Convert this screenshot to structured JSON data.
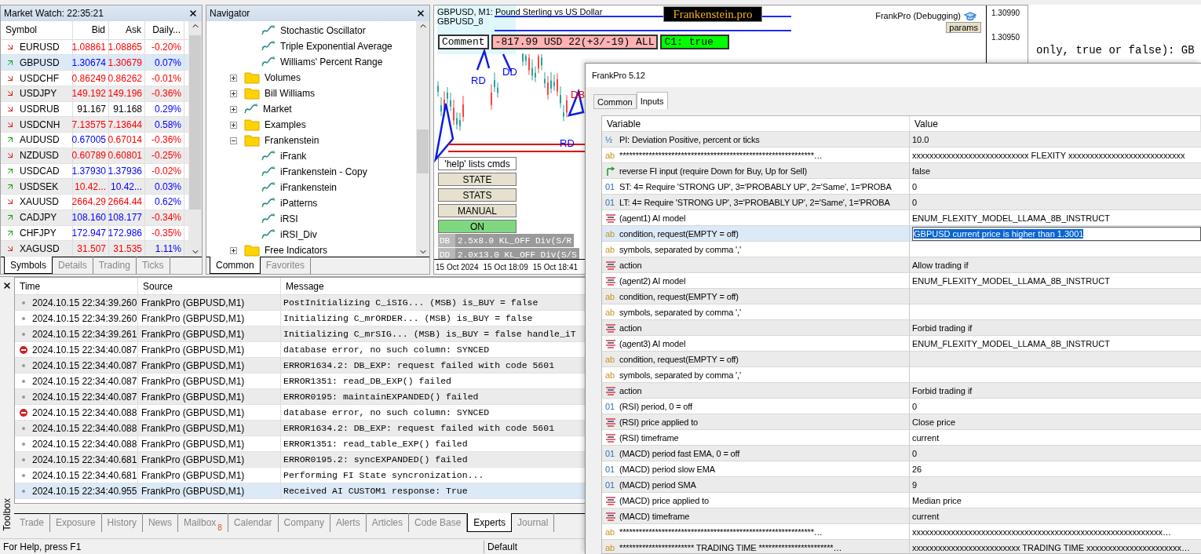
{
  "market_watch": {
    "title": "Market Watch: 22:35:21",
    "columns": [
      "Symbol",
      "Bid",
      "Ask",
      "Daily..."
    ],
    "rows": [
      {
        "symbol": "EURUSD",
        "rising": false,
        "selected": false,
        "bid": {
          "text": "1.08861",
          "color": "#ff0000"
        },
        "ask": {
          "text": "1.08865",
          "color": "#ff0000"
        },
        "daily": {
          "text": "-0.20%",
          "color": "#ff0000"
        }
      },
      {
        "symbol": "GBPUSD",
        "rising": true,
        "selected": true,
        "bid": {
          "text": "1.30674",
          "color": "#0000ff"
        },
        "ask": {
          "text": "1.30679",
          "color": "#ff0000"
        },
        "daily": {
          "text": "0.07%",
          "color": "#0000ff"
        }
      },
      {
        "symbol": "USDCHF",
        "rising": false,
        "selected": false,
        "bid": {
          "text": "0.86249",
          "color": "#ff0000"
        },
        "ask": {
          "text": "0.86262",
          "color": "#ff0000"
        },
        "daily": {
          "text": "-0.01%",
          "color": "#ff0000"
        }
      },
      {
        "symbol": "USDJPY",
        "rising": false,
        "selected": false,
        "bid": {
          "text": "149.192",
          "color": "#ff0000"
        },
        "ask": {
          "text": "149.196",
          "color": "#ff0000"
        },
        "daily": {
          "text": "-0.36%",
          "color": "#ff0000"
        }
      },
      {
        "symbol": "USDRUB",
        "rising": false,
        "selected": false,
        "bid": {
          "text": "91.167",
          "color": "#000000"
        },
        "ask": {
          "text": "91.168",
          "color": "#000000"
        },
        "daily": {
          "text": "0.29%",
          "color": "#0000ff"
        }
      },
      {
        "symbol": "USDCNH",
        "rising": false,
        "selected": false,
        "bid": {
          "text": "7.13575",
          "color": "#ff0000"
        },
        "ask": {
          "text": "7.13644",
          "color": "#ff0000"
        },
        "daily": {
          "text": "0.58%",
          "color": "#0000ff"
        }
      },
      {
        "symbol": "AUDUSD",
        "rising": true,
        "selected": false,
        "bid": {
          "text": "0.67005",
          "color": "#0000ff"
        },
        "ask": {
          "text": "0.67014",
          "color": "#ff0000"
        },
        "daily": {
          "text": "-0.36%",
          "color": "#ff0000"
        }
      },
      {
        "symbol": "NZDUSD",
        "rising": false,
        "selected": false,
        "bid": {
          "text": "0.60789",
          "color": "#ff0000"
        },
        "ask": {
          "text": "0.60801",
          "color": "#ff0000"
        },
        "daily": {
          "text": "-0.25%",
          "color": "#ff0000"
        }
      },
      {
        "symbol": "USDCAD",
        "rising": true,
        "selected": false,
        "bid": {
          "text": "1.37930",
          "color": "#0000ff"
        },
        "ask": {
          "text": "1.37936",
          "color": "#0000ff"
        },
        "daily": {
          "text": "-0.02%",
          "color": "#ff0000"
        }
      },
      {
        "symbol": "USDSEK",
        "rising": true,
        "selected": false,
        "bid": {
          "text": "10.42...",
          "color": "#ff0000"
        },
        "ask": {
          "text": "10.42...",
          "color": "#0000ff"
        },
        "daily": {
          "text": "0.03%",
          "color": "#0000ff"
        }
      },
      {
        "symbol": "XAUUSD",
        "rising": false,
        "selected": false,
        "bid": {
          "text": "2664.29",
          "color": "#ff0000"
        },
        "ask": {
          "text": "2664.44",
          "color": "#ff0000"
        },
        "daily": {
          "text": "0.62%",
          "color": "#0000ff"
        }
      },
      {
        "symbol": "CADJPY",
        "rising": true,
        "selected": false,
        "bid": {
          "text": "108.160",
          "color": "#0000ff"
        },
        "ask": {
          "text": "108.177",
          "color": "#0000ff"
        },
        "daily": {
          "text": "-0.34%",
          "color": "#ff0000"
        }
      },
      {
        "symbol": "CHFJPY",
        "rising": true,
        "selected": false,
        "bid": {
          "text": "172.947",
          "color": "#0000ff"
        },
        "ask": {
          "text": "172.986",
          "color": "#0000ff"
        },
        "daily": {
          "text": "-0.35%",
          "color": "#ff0000"
        }
      },
      {
        "symbol": "XAGUSD",
        "rising": false,
        "selected": false,
        "bid": {
          "text": "31.507",
          "color": "#ff0000"
        },
        "ask": {
          "text": "31.535",
          "color": "#ff0000"
        },
        "daily": {
          "text": "1.11%",
          "color": "#0000ff"
        }
      }
    ],
    "tabs": [
      {
        "label": "Symbols",
        "selected": true
      },
      {
        "label": "Details",
        "selected": false
      },
      {
        "label": "Trading",
        "selected": false
      },
      {
        "label": "Ticks",
        "selected": false
      }
    ]
  },
  "navigator": {
    "title": "Navigator",
    "tree": [
      {
        "kind": "branch",
        "children": [
          {
            "kind": "indicator",
            "label": "Stochastic Oscillator"
          },
          {
            "kind": "indicator",
            "label": "Triple Exponential Average"
          },
          {
            "kind": "indicator",
            "label": "Williams' Percent Range"
          }
        ]
      },
      {
        "kind": "folder",
        "label": "Volumes",
        "expanded": false
      },
      {
        "kind": "folder",
        "label": "Bill Williams",
        "expanded": false
      },
      {
        "kind": "indicator",
        "label": "Market",
        "expanded": false
      },
      {
        "kind": "folder",
        "label": "Examples",
        "expanded": false
      },
      {
        "kind": "folder",
        "label": "Frankenstein",
        "expanded": true,
        "children": [
          {
            "kind": "indicator",
            "label": "iFrank"
          },
          {
            "kind": "indicator",
            "label": "iFrankenstein - Copy"
          },
          {
            "kind": "indicator",
            "label": "iFrankenstein"
          },
          {
            "kind": "indicator",
            "label": "iPatterns"
          },
          {
            "kind": "indicator",
            "label": "iRSI"
          },
          {
            "kind": "indicator",
            "label": "iRSI_Div"
          }
        ]
      },
      {
        "kind": "folder",
        "label": "Free Indicators",
        "expanded": false
      }
    ],
    "tabs": [
      {
        "label": "Common",
        "selected": true
      },
      {
        "label": "Favorites",
        "selected": false
      }
    ]
  },
  "chart": {
    "title": "GBPUSD, M1:  Pound Sterling vs US Dollar",
    "subtitle": "GBPUSD_8",
    "brand_label": "Frankenstein.pro",
    "expert": "FrankPro (Debugging)",
    "params_button": "params",
    "price_labels": [
      "1.30990",
      "1.30950"
    ],
    "comment_label": "Comment",
    "pnl": "-817.99 USD 22(+3/-19) ALL",
    "condition": {
      "text": "C1: true",
      "on": true
    },
    "patterns": [
      {
        "text": "RD",
        "color": "#0000ff"
      },
      {
        "text": "DD",
        "color": "#0000ff"
      },
      {
        "text": "DB",
        "color": "#ff0000"
      },
      {
        "text": "RD",
        "color": "#0000ff"
      }
    ],
    "help_hint": "'help' lists cmds",
    "buttons": [
      {
        "label": "STATE",
        "on": false
      },
      {
        "label": "STATS",
        "on": false
      },
      {
        "label": "MANUAL",
        "on": false
      },
      {
        "label": "ON",
        "on": true
      }
    ],
    "info_rows": [
      {
        "tag": "DB",
        "text": "2.5x8.0 KL_OFF Div(S/R"
      },
      {
        "tag": "DD",
        "text": "2.0x13.0 KL_OFF Div(S/S"
      }
    ],
    "time_labels": [
      "15 Oct 2024",
      "15 Oct 18:09",
      "15 Oct 18:41"
    ]
  },
  "background_text": "only, true or false): GB",
  "toolbox": {
    "side_label": "Toolbox",
    "columns": [
      "Time",
      "Source",
      "Message"
    ],
    "rows": [
      {
        "kind": "info",
        "time": "2024.10.15 22:34:39.260",
        "source": "FrankPro (GBPUSD,M1)",
        "message": "PostInitializing C_iSIG... (MSB)  is_BUY = false",
        "selected": false
      },
      {
        "kind": "info",
        "time": "2024.10.15 22:34:39.260",
        "source": "FrankPro (GBPUSD,M1)",
        "message": "Initializing C_mrORDER... (MSB)  is_BUY = false",
        "selected": false
      },
      {
        "kind": "info",
        "time": "2024.10.15 22:34:39.261",
        "source": "FrankPro (GBPUSD,M1)",
        "message": "Initializing C_mrSIG... (MSB)  is_BUY = false handle_iT",
        "selected": false
      },
      {
        "kind": "error",
        "time": "2024.10.15 22:34:40.087",
        "source": "FrankPro (GBPUSD,M1)",
        "message": "database error, no such column: SYNCED",
        "selected": false
      },
      {
        "kind": "info",
        "time": "2024.10.15 22:34:40.087",
        "source": "FrankPro (GBPUSD,M1)",
        "message": "ERROR1634.2: DB_EXP: request failed with code 5601",
        "selected": false
      },
      {
        "kind": "info",
        "time": "2024.10.15 22:34:40.087",
        "source": "FrankPro (GBPUSD,M1)",
        "message": "ERROR1351: read_DB_EXP() failed",
        "selected": false
      },
      {
        "kind": "info",
        "time": "2024.10.15 22:34:40.087",
        "source": "FrankPro (GBPUSD,M1)",
        "message": "ERROR0195: maintainEXPANDED() failed",
        "selected": false
      },
      {
        "kind": "error",
        "time": "2024.10.15 22:34:40.088",
        "source": "FrankPro (GBPUSD,M1)",
        "message": "database error, no such column: SYNCED",
        "selected": false
      },
      {
        "kind": "info",
        "time": "2024.10.15 22:34:40.088",
        "source": "FrankPro (GBPUSD,M1)",
        "message": "ERROR1634.2: DB_EXP: request failed with code 5601",
        "selected": false
      },
      {
        "kind": "info",
        "time": "2024.10.15 22:34:40.088",
        "source": "FrankPro (GBPUSD,M1)",
        "message": "ERROR1351: read_table_EXP() failed",
        "selected": false
      },
      {
        "kind": "info",
        "time": "2024.10.15 22:34:40.681",
        "source": "FrankPro (GBPUSD,M1)",
        "message": "ERROR0195.2: syncEXPANDED() failed",
        "selected": false
      },
      {
        "kind": "info",
        "time": "2024.10.15 22:34:40.681",
        "source": "FrankPro (GBPUSD,M1)",
        "message": "Performing FI State syncronization...",
        "selected": false
      },
      {
        "kind": "info",
        "time": "2024.10.15 22:34:40.955",
        "source": "FrankPro (GBPUSD,M1)",
        "message": "Received AI CUSTOM1 response: True",
        "selected": true
      }
    ],
    "tabs": [
      {
        "label": "Trade",
        "selected": false
      },
      {
        "label": "Exposure",
        "selected": false
      },
      {
        "label": "History",
        "selected": false
      },
      {
        "label": "News",
        "selected": false
      },
      {
        "label": "Mailbox",
        "badge": "8",
        "selected": false
      },
      {
        "label": "Calendar",
        "selected": false
      },
      {
        "label": "Company",
        "selected": false
      },
      {
        "label": "Alerts",
        "selected": false
      },
      {
        "label": "Articles",
        "selected": false
      },
      {
        "label": "Code Base",
        "selected": false
      },
      {
        "label": "Experts",
        "selected": true
      },
      {
        "label": "Journal",
        "selected": false
      }
    ]
  },
  "status_bar": {
    "help": "For Help, press F1",
    "profile": "Default"
  },
  "dialog": {
    "title": "FrankPro 5.12",
    "tabs": [
      {
        "label": "Common",
        "selected": false
      },
      {
        "label": "Inputs",
        "selected": true
      }
    ],
    "columns": [
      "Variable",
      "Value"
    ],
    "rows": [
      {
        "kind": "double",
        "icon": "½",
        "name": "PI: Deviation Positive, percent or ticks",
        "value": "10.0",
        "selected": false
      },
      {
        "kind": "string",
        "icon": "ab",
        "name": "************************************************************…",
        "value": "xxxxxxxxxxxxxxxxxxxxxxxxxxx FLEXITY xxxxxxxxxxxxxxxxxxxxxxxxxxx",
        "selected": false
      },
      {
        "kind": "bool",
        "name": "reverse FI input (require Down for Buy, Up for Sell)",
        "value": "false",
        "selected": false
      },
      {
        "kind": "int",
        "icon": "01",
        "name": "ST: 4= Require 'STRONG UP', 3='PROBABLY UP', 2='Same', 1='PROBA",
        "value": "0",
        "selected": false
      },
      {
        "kind": "int",
        "icon": "01",
        "name": "LT: 4= Require 'STRONG UP', 3='PROBABLY UP', 2='Same', 1='PROBA",
        "value": "0",
        "selected": false
      },
      {
        "kind": "enum",
        "name": "(agent1) AI model",
        "value": "ENUM_FLEXITY_MODEL_LLAMA_8B_INSTRUCT",
        "selected": false
      },
      {
        "kind": "string",
        "icon": "ab",
        "name": "condition, request(EMPTY = off)",
        "value": "GBPUSD current price is higher than 1.3001",
        "selected": true
      },
      {
        "kind": "string",
        "icon": "ab",
        "name": "symbols, separated by comma ','",
        "selected": false
      },
      {
        "kind": "enum",
        "name": "action",
        "value": "Allow trading if",
        "selected": false
      },
      {
        "kind": "enum",
        "name": "(agent2) AI model",
        "value": "ENUM_FLEXITY_MODEL_LLAMA_8B_INSTRUCT",
        "selected": false
      },
      {
        "kind": "string",
        "icon": "ab",
        "name": "condition, request(EMPTY = off)",
        "selected": false
      },
      {
        "kind": "string",
        "icon": "ab",
        "name": "symbols, separated by comma ','",
        "selected": false
      },
      {
        "kind": "enum",
        "name": "action",
        "value": "Forbid trading if",
        "selected": false
      },
      {
        "kind": "enum",
        "name": "(agent3) AI model",
        "value": "ENUM_FLEXITY_MODEL_LLAMA_8B_INSTRUCT",
        "selected": false
      },
      {
        "kind": "string",
        "icon": "ab",
        "name": "condition, request(EMPTY = off)",
        "selected": false
      },
      {
        "kind": "string",
        "icon": "ab",
        "name": "symbols, separated by comma ','",
        "selected": false
      },
      {
        "kind": "enum",
        "name": "action",
        "value": "Forbid trading if",
        "selected": false
      },
      {
        "kind": "int",
        "icon": "01",
        "name": "(RSI) period, 0 = off",
        "value": "0",
        "selected": false
      },
      {
        "kind": "enum",
        "name": "(RSI) price applied to",
        "value": "Close price",
        "selected": false
      },
      {
        "kind": "enum",
        "name": "(RSI) timeframe",
        "value": "current",
        "selected": false
      },
      {
        "kind": "int",
        "icon": "01",
        "name": "(MACD) period fast EMA, 0 = off",
        "value": "0",
        "selected": false
      },
      {
        "kind": "int",
        "icon": "01",
        "name": "(MACD) period slow EMA",
        "value": "26",
        "selected": false
      },
      {
        "kind": "int",
        "icon": "01",
        "name": "(MACD) period SMA",
        "value": "9",
        "selected": false
      },
      {
        "kind": "enum",
        "name": "(MACD) price applied to",
        "value": "Median price",
        "selected": false
      },
      {
        "kind": "enum",
        "name": "(MACD) timeframe",
        "value": "current",
        "selected": false
      },
      {
        "kind": "string",
        "icon": "ab",
        "name": "************************************************************…",
        "value": "xxxxxxxxxxxxxxxxxxxxxxxxxxxxxxxxxxxxxxxxxxxxxxxxxxxxxxxxxx…",
        "selected": false
      },
      {
        "kind": "string",
        "icon": "ab",
        "name": "*********************** TRADING TIME ***********************…",
        "value": "xxxxxxxxxxxxxxxxxxxxxxxxx TRADING TIME xxxxxxxxxxxxxxxxxxxxxx…",
        "selected": false
      }
    ]
  }
}
